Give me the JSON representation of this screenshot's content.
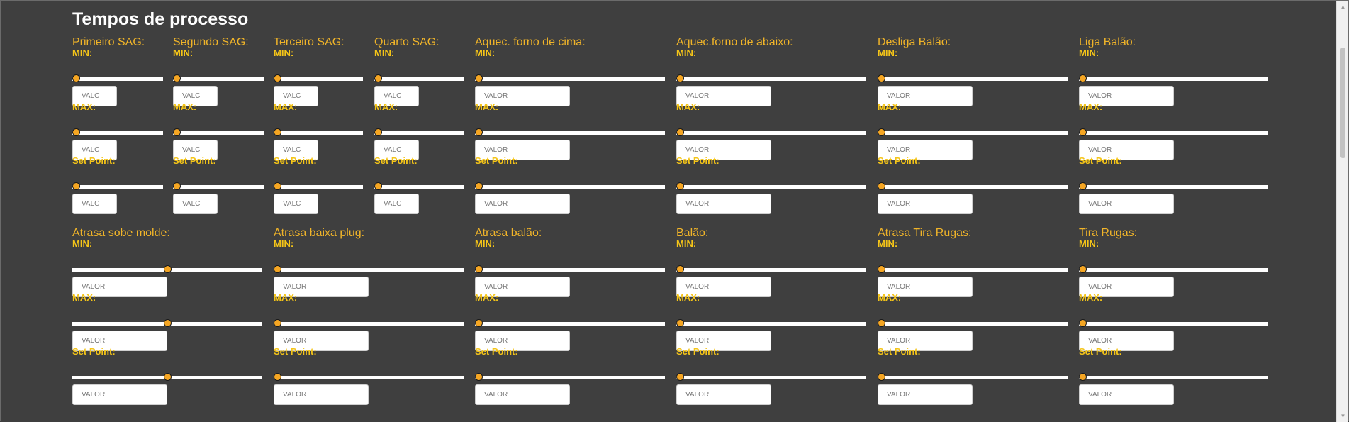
{
  "page": {
    "title": "Tempos de processo"
  },
  "labels": {
    "min": "MIN:",
    "max": "MAX:",
    "setpoint": "Set Point:"
  },
  "placeholders": {
    "short": "VALC",
    "long": "VALOR"
  },
  "colors": {
    "background": "#3f3f3f",
    "label": "#f0b429",
    "thumb": "#f5a623",
    "track": "#ffffff"
  },
  "groups": [
    {
      "label": "Primeiro SAG:",
      "levels": {
        "min": 0,
        "max": 0,
        "setpoint": 0
      }
    },
    {
      "label": "Segundo SAG:",
      "levels": {
        "min": 0,
        "max": 0,
        "setpoint": 0
      }
    },
    {
      "label": "Terceiro SAG:",
      "levels": {
        "min": 0,
        "max": 0,
        "setpoint": 0
      }
    },
    {
      "label": "Quarto SAG:",
      "levels": {
        "min": 0,
        "max": 0,
        "setpoint": 0
      }
    },
    {
      "label": "Aquec. forno de cima:",
      "levels": {
        "min": 0,
        "max": 0,
        "setpoint": 0
      }
    },
    {
      "label": "Aquec.forno de abaixo:",
      "levels": {
        "min": 0,
        "max": 0,
        "setpoint": 0
      }
    },
    {
      "label": "Desliga Balão:",
      "levels": {
        "min": 0,
        "max": 0,
        "setpoint": 0
      }
    },
    {
      "label": "Liga Balão:",
      "levels": {
        "min": 0,
        "max": 0,
        "setpoint": 0
      }
    },
    {
      "label": "Atrasa sobe molde:",
      "levels": {
        "min": 0.5,
        "max": 0.5,
        "setpoint": 0.5
      }
    },
    {
      "label": "Atrasa baixa plug:",
      "levels": {
        "min": 0,
        "max": 0,
        "setpoint": 0
      }
    },
    {
      "label": "Atrasa balão:",
      "levels": {
        "min": 0,
        "max": 0,
        "setpoint": 0
      }
    },
    {
      "label": "Balão:",
      "levels": {
        "min": 0,
        "max": 0,
        "setpoint": 0
      }
    },
    {
      "label": "Atrasa Tira Rugas:",
      "levels": {
        "min": 0,
        "max": 0,
        "setpoint": 0
      }
    },
    {
      "label": "Tira Rugas:",
      "levels": {
        "min": 0,
        "max": 0,
        "setpoint": 0
      }
    }
  ]
}
